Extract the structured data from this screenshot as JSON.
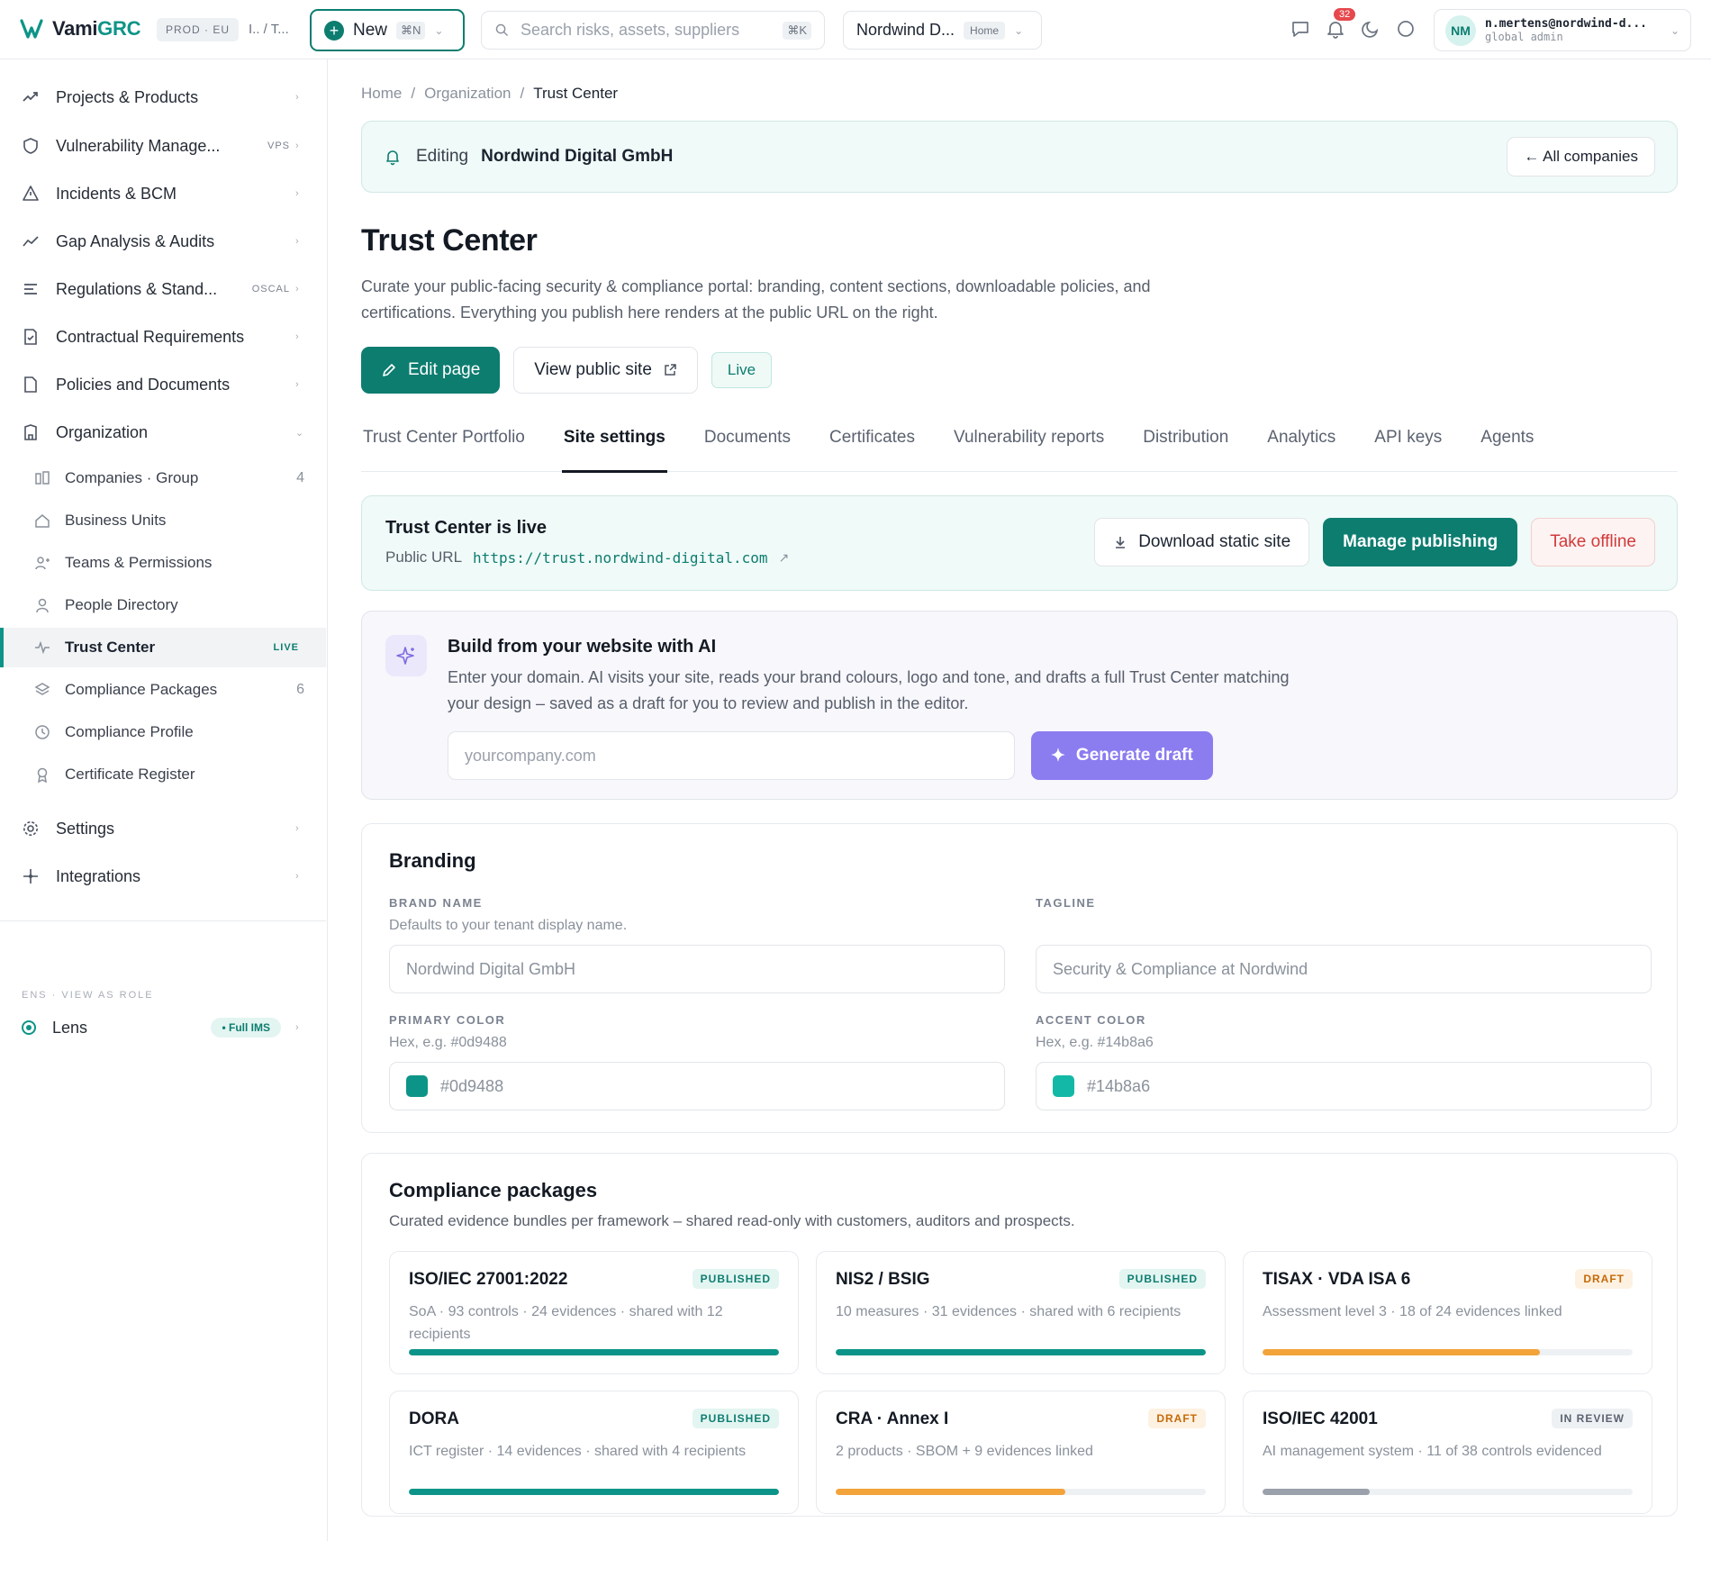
{
  "colors": {
    "primary": "#0d7d70",
    "teal": "#0d9488",
    "accent_purple": "#8b7cf0",
    "danger": "#d23a3a",
    "progress_published": "#0d9488",
    "progress_draft": "#f2a33a",
    "progress_review": "#9aa1ab"
  },
  "topbar": {
    "brand_prefix": "Vami",
    "brand_suffix": "GRC",
    "env": "PROD · EU",
    "crumb_short": "I.. / T...",
    "new_label": "New",
    "new_shortcut": "⌘N",
    "search_placeholder": "Search risks, assets, suppliers",
    "search_shortcut": "⌘K",
    "context_name": "Nordwind D...",
    "context_badge": "Home",
    "notifications": "32",
    "user_initials": "NM",
    "user_email": "n.mertens@nordwind-d...",
    "user_role": "global admin"
  },
  "sidebar": {
    "items": [
      {
        "label": "Projects & Products",
        "icon": "trend-icon",
        "tag": ""
      },
      {
        "label": "Vulnerability Manage...",
        "icon": "shield-icon",
        "tag": "VPS"
      },
      {
        "label": "Incidents & BCM",
        "icon": "warning-icon",
        "tag": ""
      },
      {
        "label": "Gap Analysis & Audits",
        "icon": "chart-line-icon",
        "tag": ""
      },
      {
        "label": "Regulations & Stand...",
        "icon": "list-icon",
        "tag": "OSCAL"
      },
      {
        "label": "Contractual Requirements",
        "icon": "doc-check-icon",
        "tag": ""
      },
      {
        "label": "Policies and Documents",
        "icon": "file-icon",
        "tag": ""
      },
      {
        "label": "Organization",
        "icon": "building-icon",
        "tag": ""
      }
    ],
    "org_children": [
      {
        "label": "Companies · Group",
        "icon": "companies-icon",
        "count": "4"
      },
      {
        "label": "Business Units",
        "icon": "home-icon",
        "count": ""
      },
      {
        "label": "Teams & Permissions",
        "icon": "users-icon",
        "count": ""
      },
      {
        "label": "People Directory",
        "icon": "person-icon",
        "count": ""
      },
      {
        "label": "Trust Center",
        "icon": "pulse-icon",
        "count": "",
        "tag": "LIVE"
      },
      {
        "label": "Compliance Packages",
        "icon": "layers-icon",
        "count": "6"
      },
      {
        "label": "Compliance Profile",
        "icon": "clock-icon",
        "count": ""
      },
      {
        "label": "Certificate Register",
        "icon": "award-icon",
        "count": ""
      }
    ],
    "bottom_items": [
      {
        "label": "Settings",
        "icon": "gear-icon"
      },
      {
        "label": "Integrations",
        "icon": "sparkle-icon"
      }
    ],
    "lens_caption": "ENS · VIEW AS ROLE",
    "lens_label": "Lens",
    "lens_badge": "• Full IMS"
  },
  "breadcrumb": [
    "Home",
    "Organization",
    "Trust Center"
  ],
  "editing": {
    "prefix": "Editing",
    "company": "Nordwind Digital GmbH",
    "all_companies": "← All companies"
  },
  "page": {
    "title": "Trust Center",
    "description": "Curate your public-facing security & compliance portal: branding, content sections, downloadable policies, and certifications. Everything you publish here renders at the public URL on the right.",
    "edit_btn": "Edit page",
    "view_btn": "View public site",
    "status": "Live"
  },
  "tabs": [
    "Trust Center Portfolio",
    "Site settings",
    "Documents",
    "Certificates",
    "Vulnerability reports",
    "Distribution",
    "Analytics",
    "API keys",
    "Agents"
  ],
  "active_tab": "Site settings",
  "live": {
    "title": "Trust Center is live",
    "url_label": "Public URL",
    "url": "https://trust.nordwind-digital.com",
    "download": "Download static site",
    "manage": "Manage publishing",
    "offline": "Take offline"
  },
  "ai": {
    "title": "Build from your website with AI",
    "description": "Enter your domain. AI visits your site, reads your brand colours, logo and tone, and drafts a full Trust Center matching your design – saved as a draft for you to review and publish in the editor.",
    "placeholder": "yourcompany.com",
    "button": "Generate draft"
  },
  "branding": {
    "title": "Branding",
    "brand_name": {
      "label": "BRAND NAME",
      "help": "Defaults to your tenant display name.",
      "placeholder": "Nordwind Digital GmbH"
    },
    "tagline": {
      "label": "TAGLINE",
      "help": "",
      "placeholder": "Security & Compliance at Nordwind"
    },
    "primary_color": {
      "label": "PRIMARY COLOR",
      "help": "Hex, e.g. #0d9488",
      "value": "#0d9488",
      "swatch": "#0d9488"
    },
    "accent_color": {
      "label": "ACCENT COLOR",
      "help": "Hex, e.g. #14b8a6",
      "value": "#14b8a6",
      "swatch": "#14b8a6"
    }
  },
  "packages": {
    "title": "Compliance packages",
    "subtitle": "Curated evidence bundles per framework – shared read-only with customers, auditors and prospects.",
    "items": [
      {
        "name": "ISO/IEC 27001:2022",
        "status": "PUBLISHED",
        "desc": "SoA · 93 controls · 24 evidences · shared with 12 recipients",
        "progress": 1.0
      },
      {
        "name": "NIS2 / BSIG",
        "status": "PUBLISHED",
        "desc": "10 measures · 31 evidences · shared with 6 recipients",
        "progress": 1.0
      },
      {
        "name": "TISAX · VDA ISA 6",
        "status": "DRAFT",
        "desc": "Assessment level 3 · 18 of 24 evidences linked",
        "progress": 0.75
      },
      {
        "name": "DORA",
        "status": "PUBLISHED",
        "desc": "ICT register · 14 evidences · shared with 4 recipients",
        "progress": 1.0
      },
      {
        "name": "CRA · Annex I",
        "status": "DRAFT",
        "desc": "2 products · SBOM + 9 evidences linked",
        "progress": 0.62
      },
      {
        "name": "ISO/IEC 42001",
        "status": "IN REVIEW",
        "desc": "AI management system · 11 of 38 controls evidenced",
        "progress": 0.29
      }
    ]
  }
}
